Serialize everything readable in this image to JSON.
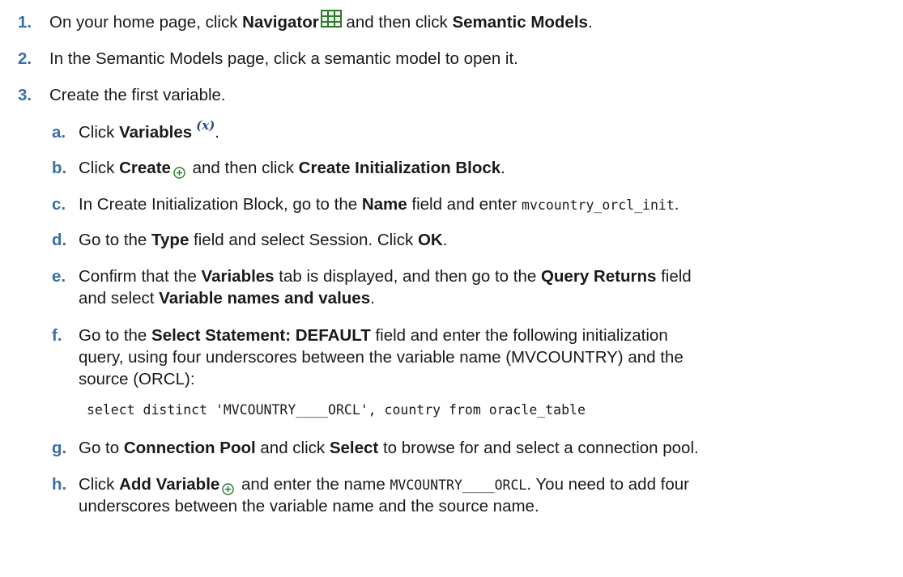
{
  "steps": [
    {
      "number": "1.",
      "t1": "On your home page, click ",
      "b1": "Navigator",
      "t2": " and then click ",
      "b2": "Semantic Models",
      "t3": "."
    },
    {
      "number": "2.",
      "t1": "In the Semantic Models page, click a semantic model to open it."
    },
    {
      "number": "3.",
      "t1": "Create the first variable."
    }
  ],
  "substeps": {
    "a": {
      "letter": "a.",
      "t1": "Click ",
      "b1": "Variables",
      "icon_text": "(x)",
      "t2": "."
    },
    "b": {
      "letter": "b.",
      "t1": "Click ",
      "b1": "Create",
      "t2": " and then click ",
      "b2": "Create Initialization Block",
      "t3": "."
    },
    "c": {
      "letter": "c.",
      "t1": "In Create Initialization Block, go to the ",
      "b1": "Name",
      "t2": " field and enter ",
      "code": "mvcountry_orcl_init",
      "t3": "."
    },
    "d": {
      "letter": "d.",
      "t1": "Go to the ",
      "b1": "Type",
      "t2": " field and select Session. Click ",
      "b2": "OK",
      "t3": "."
    },
    "e": {
      "letter": "e.",
      "line1_t1": "Confirm that the ",
      "line1_b1": "Variables",
      "line1_t2": " tab is displayed, and then go to the ",
      "line1_b2": "Query Returns",
      "line1_t3": " field",
      "line2_t1": "and select ",
      "line2_b1": "Variable names and values",
      "line2_t2": "."
    },
    "f": {
      "letter": "f.",
      "line1_t1": "Go to the ",
      "line1_b1": "Select Statement: DEFAULT",
      "line1_t2": " field and enter the following initialization",
      "line2": "query, using four underscores between the variable name (MVCOUNTRY) and the",
      "line3": "source (ORCL):",
      "code": "select distinct 'MVCOUNTRY____ORCL', country from oracle_table"
    },
    "g": {
      "letter": "g.",
      "t1": "Go to ",
      "b1": "Connection Pool",
      "t2": " and click ",
      "b2": "Select",
      "t3": " to browse for and select a connection pool."
    },
    "h": {
      "letter": "h.",
      "line1_t1": "Click ",
      "line1_b1": "Add Variable",
      "line1_t2": " and enter the name ",
      "line1_code": "MVCOUNTRY____ORCL",
      "line1_t3": ". You need to add four",
      "line2": "underscores between the variable name and the source name."
    }
  },
  "colors": {
    "number": "#3a6fa5",
    "text": "#1a1a1a",
    "icon_blue": "#2b4f8a"
  },
  "icons": {
    "navigator": "navigator-grid-icon",
    "variables": "variables-icon",
    "create": "add-circle-icon"
  }
}
